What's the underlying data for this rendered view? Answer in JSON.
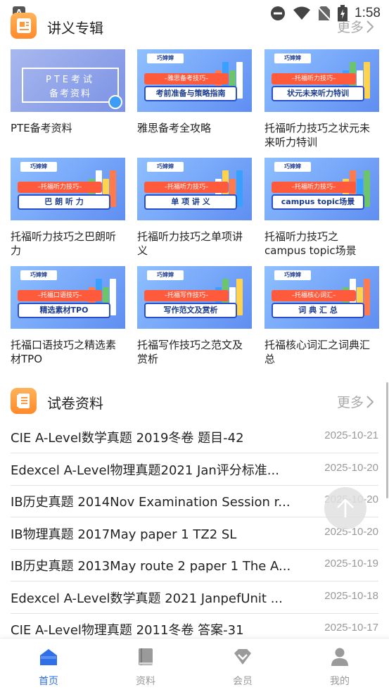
{
  "status_bar": {
    "time": "1:58",
    "app_icon_letter": "A"
  },
  "lecture_section": {
    "title": "讲义专辑",
    "more": "更多",
    "cards": [
      {
        "caption": "PTE备考资料",
        "logo": "",
        "pill": "",
        "box": "",
        "pte_line1": "PTE考试",
        "pte_line2": "备考资料"
      },
      {
        "caption": "雅思备考全攻略",
        "logo": "巧婶婶",
        "pill": "–雅思备考技巧–",
        "box": "考前准备与策略指南"
      },
      {
        "caption": "托福听力技巧之状元未来听力特训",
        "logo": "巧婶婶",
        "pill": "–托福听力技巧–",
        "box": "状元未来听力特训"
      },
      {
        "caption": "托福听力技巧之巴朗听力",
        "logo": "巧婶婶",
        "pill": "–托福听力技巧–",
        "box": "巴 朗 听 力"
      },
      {
        "caption": "托福听力技巧之单项讲义",
        "logo": "巧婶婶",
        "pill": "–托福听力技巧–",
        "box": "单 项 讲 义"
      },
      {
        "caption": "托福听力技巧之campus topic场景",
        "logo": "巧婶婶",
        "pill": "–托福听力技巧–",
        "box": "campus topic场景"
      },
      {
        "caption": "托福口语技巧之精选素材TPO",
        "logo": "巧婶婶",
        "pill": "–托福口语技巧–",
        "box": "精选素材TPO"
      },
      {
        "caption": "托福写作技巧之范文及赏析",
        "logo": "巧婶婶",
        "pill": "–托福写作技巧–",
        "box": "写作范文及赏析"
      },
      {
        "caption": "托福核心词汇之词典汇总",
        "logo": "巧婶婶",
        "pill": "–托福核心词汇–",
        "box": "词 典 汇 总"
      }
    ]
  },
  "papers_section": {
    "title": "试卷资料",
    "more": "更多",
    "items": [
      {
        "title": "CIE A-Level数学真题 2019冬卷 题目-42",
        "date": "2025-10-21"
      },
      {
        "title": "Edexcel A-Level物理真题2021 Jan评分标准...",
        "date": "2025-10-20"
      },
      {
        "title": "IB历史真题 2014Nov Examination Session r...",
        "date": "2025-10-20"
      },
      {
        "title": "IB物理真题 2017May paper 1 TZ2 SL",
        "date": "2025-10-20"
      },
      {
        "title": "IB历史真题 2013May route 2 paper 1 The A...",
        "date": "2025-10-19"
      },
      {
        "title": "Edexcel A-Level数学真题 2021 JanpefUnit ...",
        "date": "2025-10-18"
      },
      {
        "title": "CIE A-Level物理真题 2011冬卷 答案-31",
        "date": "2025-10-17"
      }
    ]
  },
  "bottom_nav": {
    "items": [
      {
        "label": "首页",
        "icon": "home-icon",
        "active": true
      },
      {
        "label": "资料",
        "icon": "book-icon",
        "active": false
      },
      {
        "label": "会员",
        "icon": "diamond-icon",
        "active": false
      },
      {
        "label": "我的",
        "icon": "person-icon",
        "active": false
      }
    ]
  },
  "colors": {
    "accent": "#2f6fe8",
    "section_icon": "#ff9a3c",
    "pill": "#ff5a3c"
  }
}
